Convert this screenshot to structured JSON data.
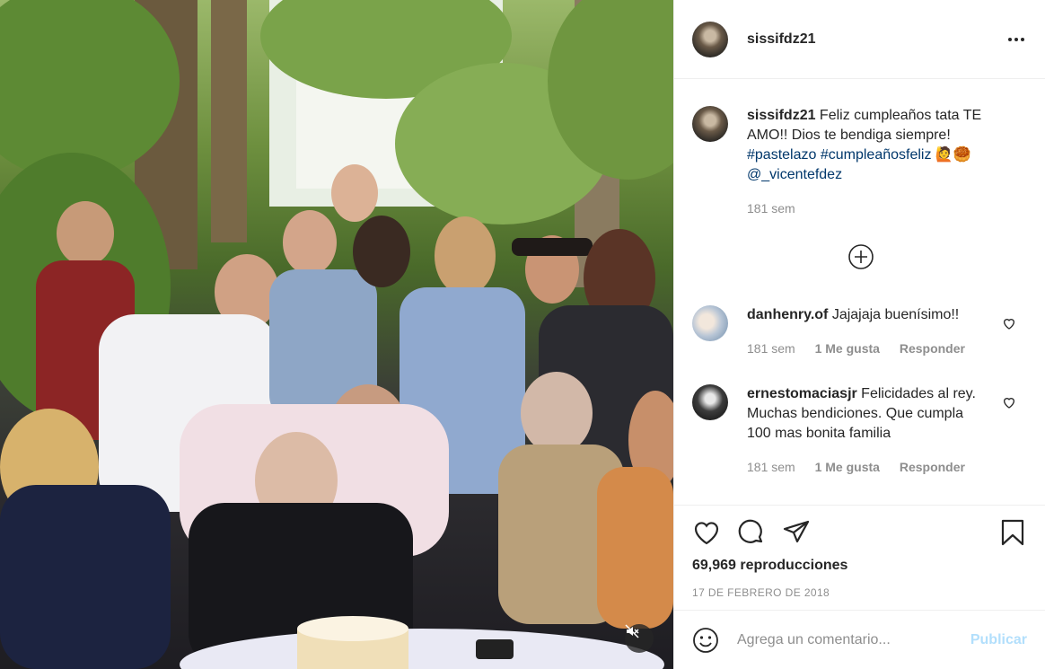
{
  "post": {
    "username": "sissifdz21",
    "more_icon": "more-horizontal-icon"
  },
  "caption": {
    "username": "sissifdz21",
    "text_1": " Feliz cumpleaños tata TE AMO!! Dios te bendiga siempre!",
    "hashtag_1": "#pastelazo",
    "hashtag_2": "#cumpleañosfeliz",
    "emojis": " 🙋🥮",
    "mention": "@_vicentefdez",
    "time": "181 sem"
  },
  "load_more_icon": "plus-circle-icon",
  "comments": [
    {
      "username": "danhenry.of",
      "text": " Jajajaja buenísimo!!",
      "time": "181 sem",
      "likes": "1 Me gusta",
      "reply": "Responder"
    },
    {
      "username": "ernestomaciasjr",
      "text": " Felicidades al rey. Muchas bendiciones. Que cumpla 100 mas bonita familia",
      "time": "181 sem",
      "likes": "1 Me gusta",
      "reply": "Responder"
    }
  ],
  "actions": {
    "icons": [
      "heart-icon",
      "comment-icon",
      "share-icon",
      "bookmark-icon"
    ],
    "views": "69,969 reproducciones",
    "date": "17 DE FEBRERO DE 2018"
  },
  "add_comment": {
    "placeholder": "Agrega un comentario...",
    "post_label": "Publicar"
  },
  "colors": {
    "text": "#262626",
    "secondary": "#8e8e8e",
    "link": "#00376b",
    "post_disabled": "#b2dffc",
    "border": "#efefef"
  }
}
